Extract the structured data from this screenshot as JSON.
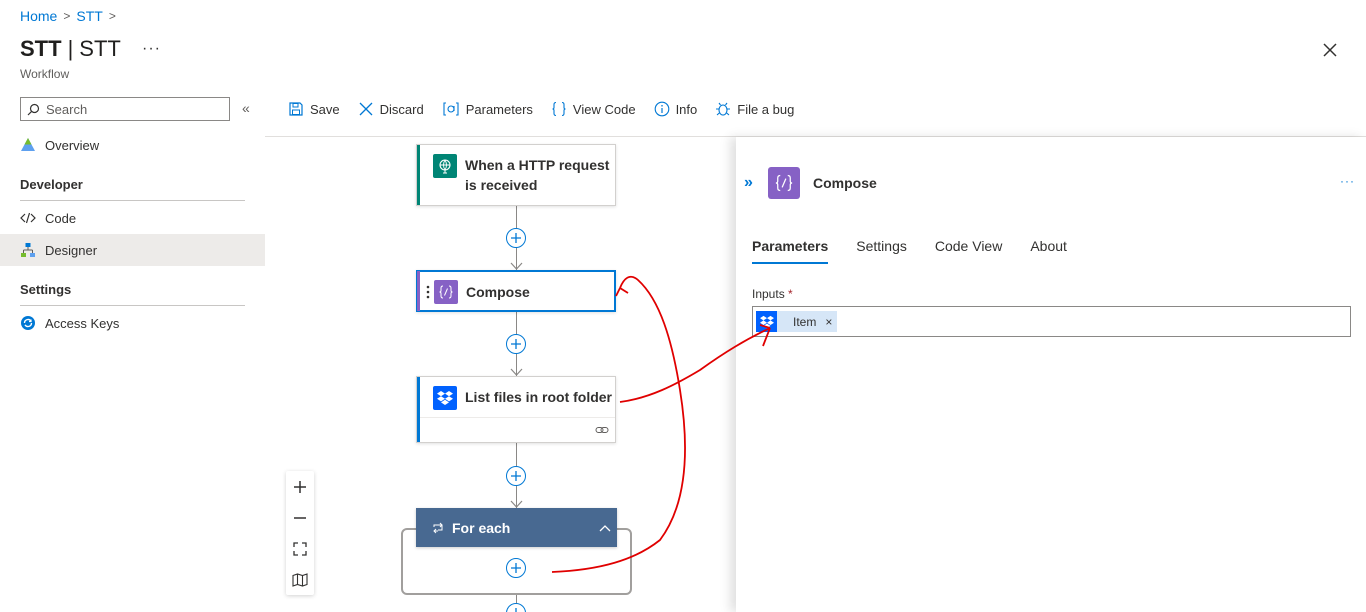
{
  "breadcrumb": {
    "home": "Home",
    "item": "STT",
    "sep": ">"
  },
  "header": {
    "title_bold": "STT",
    "title_sep": "|",
    "title_rest": "STT",
    "more": "···",
    "subtitle": "Workflow",
    "close": "×"
  },
  "sidebar": {
    "search_placeholder": "Search",
    "collapse": "«",
    "items": [
      {
        "label": "Overview",
        "icon": "overview-icon"
      },
      {
        "label": "Code",
        "icon": "code-icon"
      },
      {
        "label": "Designer",
        "icon": "designer-icon"
      },
      {
        "label": "Access Keys",
        "icon": "access-keys-icon"
      }
    ],
    "sections": {
      "developer": "Developer",
      "settings": "Settings"
    }
  },
  "toolbar": {
    "save": "Save",
    "discard": "Discard",
    "parameters": "Parameters",
    "view_code": "View Code",
    "info": "Info",
    "file_bug": "File a bug"
  },
  "canvas": {
    "nodes": [
      {
        "title_line1": "When a HTTP request",
        "title_line2": "is received",
        "color": "#008575"
      },
      {
        "title": "Compose",
        "color": "#8661c5"
      },
      {
        "title": "List files in root folder",
        "color": "#0061fe"
      },
      {
        "title": "For each",
        "color": "#486991"
      }
    ]
  },
  "panel": {
    "title": "Compose",
    "more": "···",
    "expand": "»",
    "tabs": [
      "Parameters",
      "Settings",
      "Code View",
      "About"
    ],
    "inputs_label": "Inputs",
    "required_mark": "*",
    "token_label": "Item",
    "token_remove": "×"
  },
  "colors": {
    "accent": "#0078d4",
    "annotation": "#e00000"
  }
}
